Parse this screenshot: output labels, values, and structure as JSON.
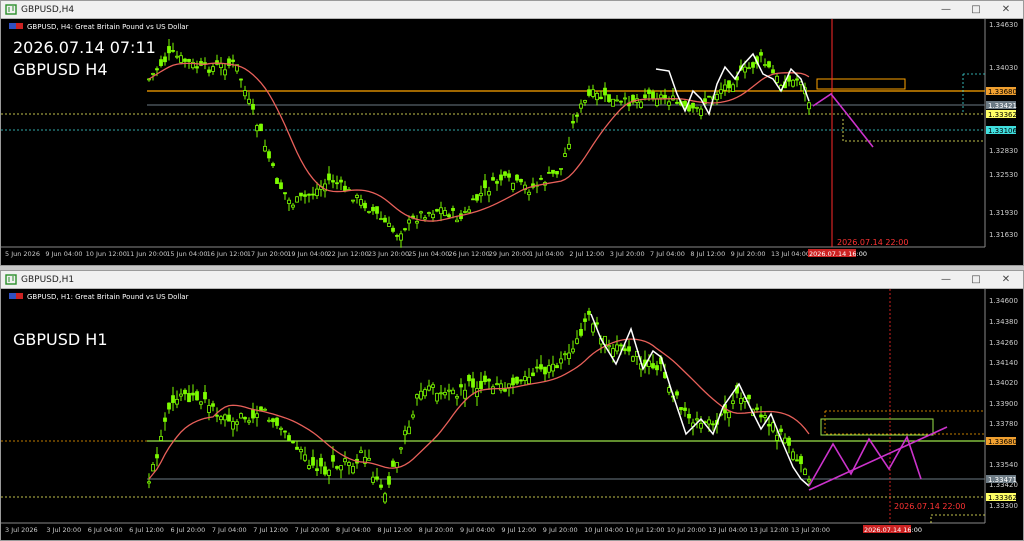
{
  "windows": [
    {
      "title": "GBPUSD,H4",
      "header": "GBPUSD, H4:  Great Britain Pound vs US Dollar",
      "overlay_line1": "2026.07.14 07:11",
      "overlay_line2": "GBPUSD H4",
      "vline_label": "2026.07.14 22:00",
      "time_marker": "2026.07.14 16:00",
      "prices": [
        "1.34630",
        "1.34030",
        "1.33680",
        "1.33421",
        "1.33362",
        "1.33106",
        "1.32830",
        "1.32530",
        "1.31930",
        "1.31630"
      ],
      "price_tags": [
        {
          "text": "1.33680",
          "bg": "#f0a030",
          "fg": "#000"
        },
        {
          "text": "1.33421",
          "bg": "#6c7a84",
          "fg": "#fff"
        },
        {
          "text": "1.33362",
          "bg": "#ffff66",
          "fg": "#000"
        },
        {
          "text": "1.33106",
          "bg": "#40e0e0",
          "fg": "#000"
        }
      ],
      "times": [
        "5 Jun 2026",
        "9 Jun 04:00",
        "10 Jun 12:00",
        "11 Jun 20:00",
        "15 Jun 04:00",
        "16 Jun 12:00",
        "17 Jun 20:00",
        "19 Jun 04:00",
        "22 Jun 12:00",
        "23 Jun 20:00",
        "25 Jun 04:00",
        "26 Jun 12:00",
        "29 Jun 20:00",
        "1 Jul 04:00",
        "2 Jul 12:00",
        "3 Jul 20:00",
        "7 Jul 04:00",
        "8 Jul 12:00",
        "9 Jul 20:00",
        "13 Jul 04:00"
      ]
    },
    {
      "title": "GBPUSD,H1",
      "header": "GBPUSD, H1:  Great Britain Pound vs US Dollar",
      "overlay_line2": "GBPUSD H1",
      "vline_label": "2026.07.14 22:00",
      "time_marker": "2026.07.14 16:00",
      "prices": [
        "1.34600",
        "1.34380",
        "1.34260",
        "1.34140",
        "1.34020",
        "1.33900",
        "1.33780",
        "1.33680",
        "1.33540",
        "1.33471",
        "1.33420",
        "1.33362",
        "1.33300"
      ],
      "price_tags": [
        {
          "text": "1.33680",
          "bg": "#f0a030",
          "fg": "#000"
        },
        {
          "text": "1.33471",
          "bg": "#6c7a84",
          "fg": "#fff"
        },
        {
          "text": "1.33362",
          "bg": "#ffff66",
          "fg": "#000"
        }
      ],
      "times": [
        "3 Jul 2026",
        "3 Jul 20:00",
        "6 Jul 04:00",
        "6 Jul 12:00",
        "6 Jul 20:00",
        "7 Jul 04:00",
        "7 Jul 12:00",
        "7 Jul 20:00",
        "8 Jul 04:00",
        "8 Jul 12:00",
        "8 Jul 20:00",
        "9 Jul 04:00",
        "9 Jul 12:00",
        "9 Jul 20:00",
        "10 Jul 04:00",
        "10 Jul 12:00",
        "10 Jul 20:00",
        "13 Jul 04:00",
        "13 Jul 12:00",
        "13 Jul 20:00"
      ]
    }
  ],
  "colors": {
    "candle": "#7cfc00",
    "ma": "#e8605a",
    "zigzag": "#ffffff",
    "projection": "#cc33cc",
    "level": "#ffa500",
    "vline": "#ff2a2a"
  }
}
